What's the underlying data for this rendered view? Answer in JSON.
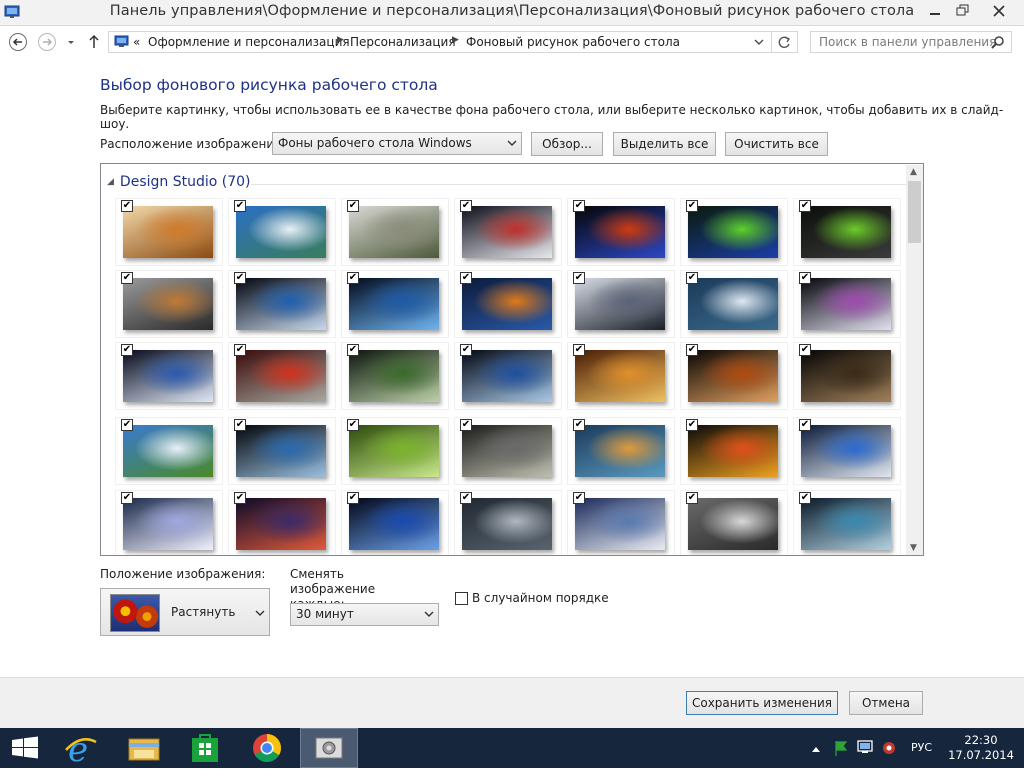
{
  "window": {
    "title": "Панель управления\\Оформление и персонализация\\Персонализация\\Фоновый рисунок рабочего стола"
  },
  "address": {
    "overflow": "«",
    "crumbs": [
      "Оформление и персонализация",
      "Персонализация",
      "Фоновый рисунок рабочего стола"
    ]
  },
  "search": {
    "placeholder": "Поиск в панели управления"
  },
  "page": {
    "heading": "Выбор фонового рисунка рабочего стола",
    "description": "Выберите картинку, чтобы использовать ее в качестве фона рабочего стола, или выберите несколько картинок, чтобы добавить их в слайд-шоу.",
    "location_label": "Расположение изображения:",
    "location_value": "Фоны рабочего стола Windows",
    "browse_label": "Обзор...",
    "select_all_label": "Выделить все",
    "clear_all_label": "Очистить все"
  },
  "gallery": {
    "group_title": "Design Studio (70)",
    "thumbnails": [
      {
        "subject": "kitten",
        "colors": [
          "#f1d9a9",
          "#d07a2a",
          "#8c4b12"
        ]
      },
      {
        "subject": "tropical-beach",
        "colors": [
          "#2b6fc4",
          "#e9f0f5",
          "#3a7d5e"
        ]
      },
      {
        "subject": "white-tigers",
        "colors": [
          "#d9d9d4",
          "#8a8c7a",
          "#4d5a3a"
        ]
      },
      {
        "subject": "planet-horizon",
        "colors": [
          "#0e0f1a",
          "#c0302a",
          "#e8e8ef"
        ]
      },
      {
        "subject": "fire-planet",
        "colors": [
          "#050505",
          "#d23a0c",
          "#2c48c6"
        ]
      },
      {
        "subject": "green-tunnel",
        "colors": [
          "#0a1a0a",
          "#5ed12a",
          "#1c3ea8"
        ]
      },
      {
        "subject": "green-cube",
        "colors": [
          "#0b0f0b",
          "#6ccc2a",
          "#3a3a3a"
        ]
      },
      {
        "subject": "tiger-cub",
        "colors": [
          "#9a9a9a",
          "#c07a35",
          "#2a2a2a"
        ]
      },
      {
        "subject": "earth-space",
        "colors": [
          "#020610",
          "#1f5fb0",
          "#c7d9ee"
        ]
      },
      {
        "subject": "blue-night",
        "colors": [
          "#020a1e",
          "#1e5aa8",
          "#6eb4f0"
        ]
      },
      {
        "subject": "sunset-city",
        "colors": [
          "#0c1a3a",
          "#e07a1a",
          "#2a5aa8"
        ]
      },
      {
        "subject": "snowy-mountains",
        "colors": [
          "#d6dbe4",
          "#5a6478",
          "#1a1f2a"
        ]
      },
      {
        "subject": "mountain-lake",
        "colors": [
          "#1c3a5a",
          "#e0e8f0",
          "#3a6a8a"
        ]
      },
      {
        "subject": "space-shards",
        "colors": [
          "#05050c",
          "#a04ab0",
          "#e0e0f0"
        ]
      },
      {
        "subject": "moon-clouds",
        "colors": [
          "#050a1c",
          "#2a5ab0",
          "#e0e8f8"
        ]
      },
      {
        "subject": "autumn-road",
        "colors": [
          "#3a0a0a",
          "#d2321e",
          "#a8a8a0"
        ]
      },
      {
        "subject": "forest-stream",
        "colors": [
          "#0c160c",
          "#3a6a2a",
          "#bcd0a8"
        ]
      },
      {
        "subject": "glass-globe",
        "colors": [
          "#020814",
          "#1e50a0",
          "#a8c8e8"
        ]
      },
      {
        "subject": "bird-branch",
        "colors": [
          "#4a1c06",
          "#e0902a",
          "#f0c060"
        ]
      },
      {
        "subject": "wine-glass",
        "colors": [
          "#0a0604",
          "#b04a10",
          "#e0a060"
        ]
      },
      {
        "subject": "dark-forest",
        "colors": [
          "#050403",
          "#3a2a18",
          "#a0805a"
        ]
      },
      {
        "subject": "green-valley",
        "colors": [
          "#3a7ad0",
          "#e8f0f8",
          "#4a8a2a"
        ]
      },
      {
        "subject": "planet-blue",
        "colors": [
          "#03050a",
          "#2a6ab0",
          "#9ac0e0"
        ]
      },
      {
        "subject": "water-drops",
        "colors": [
          "#2a4a0a",
          "#7ab42a",
          "#c8e88a"
        ]
      },
      {
        "subject": "girl-rails",
        "colors": [
          "#1a1a1a",
          "#6a6a6a",
          "#c0c0b0"
        ]
      },
      {
        "subject": "ocean-sunset",
        "colors": [
          "#1a3a5a",
          "#e09a3a",
          "#5a9ac0"
        ]
      },
      {
        "subject": "fire-car",
        "colors": [
          "#0a0a0a",
          "#e0501a",
          "#f0a020"
        ]
      },
      {
        "subject": "ice-mountain",
        "colors": [
          "#0a1a3a",
          "#2a6ad0",
          "#e0e8f0"
        ]
      },
      {
        "subject": "lightning-storm",
        "colors": [
          "#1a2a4a",
          "#a0a8e0",
          "#f0f0ff"
        ]
      },
      {
        "subject": "starry-peak",
        "colors": [
          "#0a0a2a",
          "#3a2a6a",
          "#e05a3a"
        ]
      },
      {
        "subject": "blue-hills",
        "colors": [
          "#02061a",
          "#1a4ab0",
          "#6aa0e8"
        ]
      },
      {
        "subject": "mountain-lake-2",
        "colors": [
          "#202830",
          "#b0b8c0",
          "#5a6470"
        ]
      },
      {
        "subject": "blue-mountains",
        "colors": [
          "#1a2a5a",
          "#5a7ab0",
          "#e8ecf4"
        ]
      },
      {
        "subject": "wolf",
        "colors": [
          "#6a6a6a",
          "#d8d8d8",
          "#2a2a2a"
        ]
      },
      {
        "subject": "railway-night",
        "colors": [
          "#0a1a2a",
          "#3a8ab0",
          "#b0d0e0"
        ]
      }
    ]
  },
  "controls": {
    "position_label": "Положение изображения:",
    "position_value": "Растянуть",
    "change_label": "Сменять изображение каждые:",
    "change_value": "30 минут",
    "shuffle_label": "В случайном порядке",
    "shuffle_checked": false
  },
  "footer": {
    "save_label": "Сохранить изменения",
    "cancel_label": "Отмена"
  },
  "taskbar": {
    "language": "РУС",
    "time": "22:30",
    "date": "17.07.2014"
  }
}
